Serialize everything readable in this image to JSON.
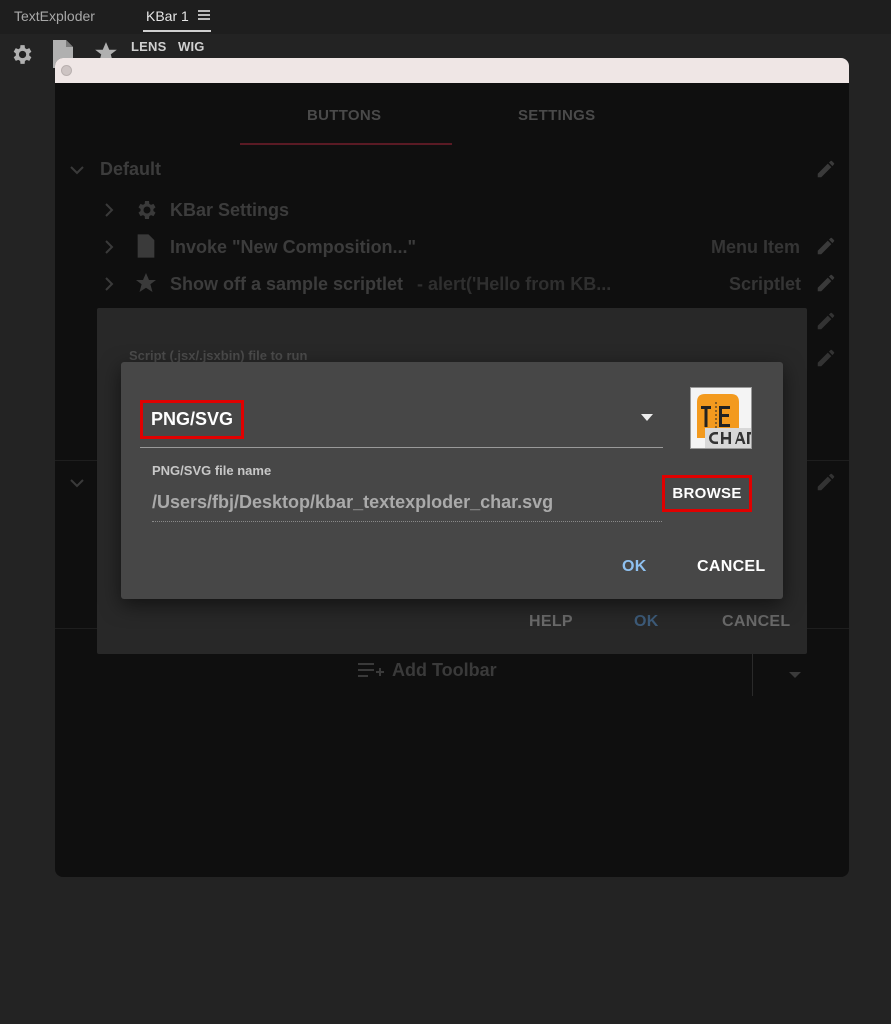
{
  "app": {
    "tabs": [
      {
        "label": "TextExploder"
      },
      {
        "label": "KBar 1"
      }
    ],
    "toolbar_buttons": [
      {
        "label": "LENS"
      },
      {
        "label": "WIG"
      }
    ],
    "toolbar_icons": [
      "gear-icon",
      "document-icon",
      "star-icon"
    ]
  },
  "window": {
    "tabs": [
      {
        "label": "BUTTONS",
        "active": true
      },
      {
        "label": "SETTINGS",
        "active": false
      }
    ],
    "section": {
      "title": "Default"
    },
    "items": [
      {
        "title": "KBar Settings",
        "detail": "",
        "type": ""
      },
      {
        "title": "Invoke \"New Composition...\"",
        "detail": "",
        "type": "Menu Item"
      },
      {
        "title": "Show off a sample scriptlet",
        "detail": "- alert('Hello from KB...",
        "type": "Scriptlet"
      }
    ],
    "add_toolbar": "Add Toolbar"
  },
  "dialog_script": {
    "label": "Script (.jsx/.jsxbin) file to run",
    "buttons": {
      "help": "HELP",
      "ok": "OK",
      "cancel": "CANCEL"
    }
  },
  "dialog_icon": {
    "source_type": "PNG/SVG",
    "file_label": "PNG/SVG file name",
    "file_value": "/Users/fbj/Desktop/kbar_textexploder_char.svg",
    "browse": "BROWSE",
    "ok": "OK",
    "cancel": "CANCEL",
    "preview_icon": "textexploder-char-icon"
  },
  "colors": {
    "highlight": "#e00000",
    "ok_blue": "#8fc1f0",
    "tab_accent": "#5a1a24"
  }
}
